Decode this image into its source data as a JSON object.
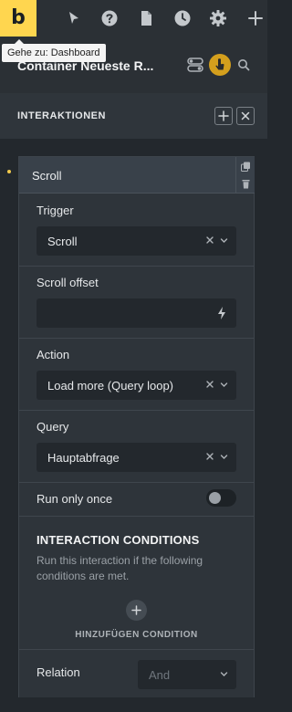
{
  "toolbar": {
    "logo_text": "b",
    "icons": [
      "pointer-icon",
      "help-icon",
      "page-icon",
      "history-icon",
      "settings-icon",
      "plus-icon"
    ]
  },
  "tooltip": {
    "text": "Gehe zu: Dashboard"
  },
  "header": {
    "title": "Container Neueste R..."
  },
  "section": {
    "title": "INTERAKTIONEN"
  },
  "card": {
    "header_label": "Scroll",
    "trigger": {
      "label": "Trigger",
      "value": "Scroll"
    },
    "scroll_offset": {
      "label": "Scroll offset",
      "value": ""
    },
    "action": {
      "label": "Action",
      "value": "Load more (Query loop)"
    },
    "query": {
      "label": "Query",
      "value": "Hauptabfrage"
    },
    "run_only_once": {
      "label": "Run only once",
      "enabled": false
    },
    "conditions": {
      "title": "INTERACTION CONDITIONS",
      "description": "Run this interaction if the following conditions are met.",
      "add_label": "HINZUFÜGEN CONDITION"
    },
    "relation": {
      "label": "Relation",
      "value": "And"
    }
  },
  "colors": {
    "accent": "#ffd64f",
    "active_cursor": "#d49f1d",
    "marker_dot": "#f2c94c",
    "background": "#23282d"
  }
}
